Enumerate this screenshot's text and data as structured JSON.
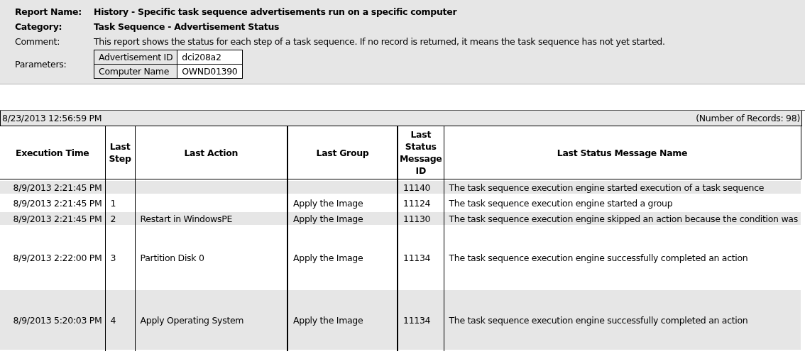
{
  "report": {
    "fields": [
      {
        "label": "Report Name:",
        "value": "History - Specific task sequence advertisements run on a specific computer",
        "bold": true
      },
      {
        "label": "Category:",
        "value": "Task Sequence - Advertisement Status",
        "bold": true
      },
      {
        "label": "Comment:",
        "value": "This report shows the status for each step of a task sequence. If no record is returned, it means the task sequence has not yet started.",
        "bold": false
      }
    ],
    "parameters_label": "Parameters:",
    "parameters": [
      {
        "name": "Advertisement ID",
        "value": "dci208a2"
      },
      {
        "name": "Computer Name",
        "value": "OWND01390"
      }
    ]
  },
  "summary": {
    "run_time": "8/23/2013 12:56:59 PM",
    "record_count": "(Number of Records: 98)"
  },
  "table": {
    "columns": [
      "Execution Time",
      "Last Step",
      "Last Action",
      "Last Group",
      "Last Status Message ID",
      "Last Status Message Name"
    ],
    "rows": [
      {
        "tall": false,
        "cells": [
          "8/9/2013 2:21:45 PM",
          "",
          "",
          "",
          "11140",
          "The task sequence execution engine started execution of a task sequence"
        ]
      },
      {
        "tall": false,
        "cells": [
          "8/9/2013 2:21:45 PM",
          "1",
          "",
          "Apply the Image",
          "11124",
          "The task sequence execution engine started a group"
        ]
      },
      {
        "tall": false,
        "cells": [
          "8/9/2013 2:21:45 PM",
          "2",
          "Restart in WindowsPE",
          "Apply the Image",
          "11130",
          "The task sequence execution engine skipped an action because the condition was"
        ]
      },
      {
        "tall": true,
        "cells": [
          "8/9/2013 2:22:00 PM",
          "3",
          "Partition Disk 0",
          "Apply the Image",
          "11134",
          "The task sequence execution engine successfully completed an action"
        ]
      },
      {
        "tall": true,
        "cells": [
          "8/9/2013 5:20:03 PM",
          "4",
          "Apply Operating System",
          "Apply the Image",
          "11134",
          "The task sequence execution engine successfully completed an action"
        ]
      }
    ]
  }
}
